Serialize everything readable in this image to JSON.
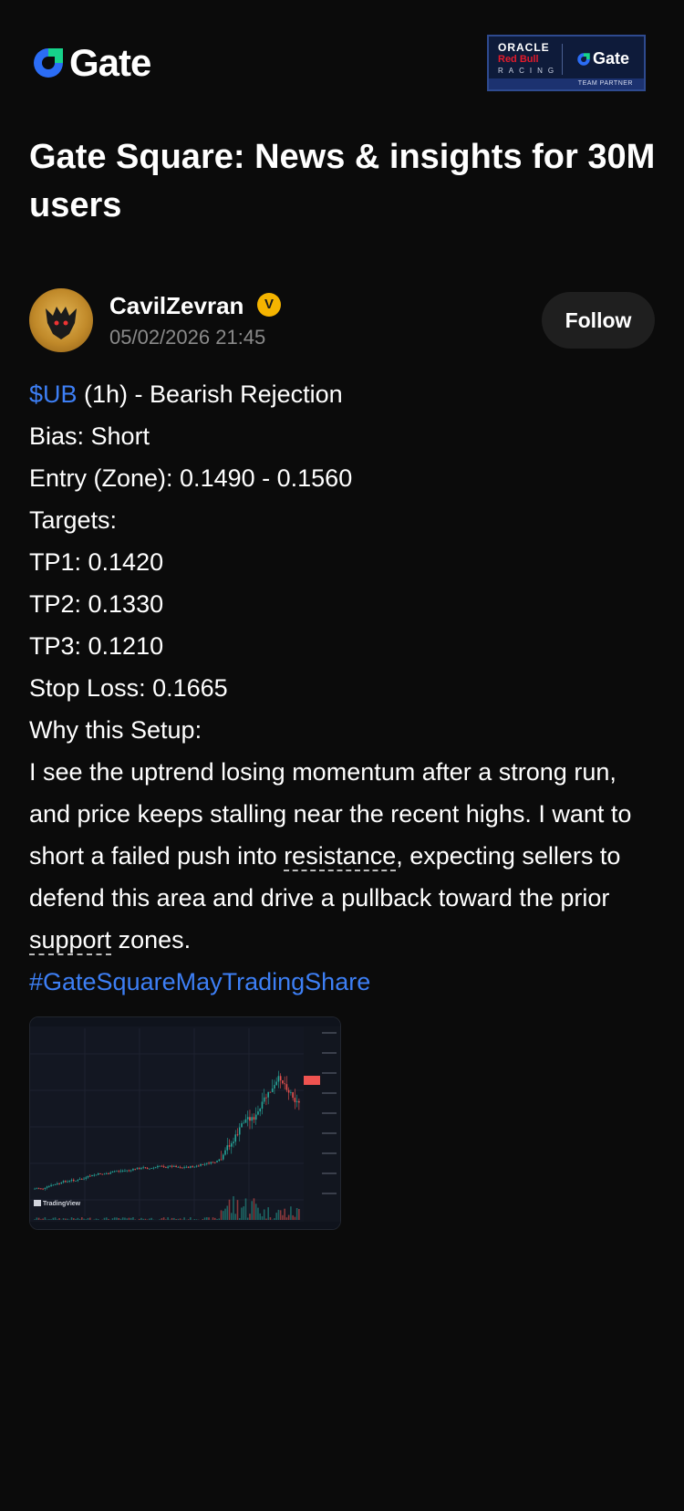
{
  "header": {
    "brand_name": "Gate",
    "partner_badge": {
      "line1": "ORACLE",
      "line2": "Red Bull",
      "line3": "RACING",
      "brand": "Gate",
      "footer": "TEAM PARTNER"
    }
  },
  "page_title": "Gate Square: News & insights for 30M users",
  "author": {
    "name": "CavilZevran",
    "verified_mark": "V",
    "timestamp": "05/02/2026 21:45",
    "follow_label": "Follow"
  },
  "post": {
    "cashtag": "$UB",
    "headline_rest": " (1h) - Bearish Rejection",
    "bias": "Bias: Short",
    "entry": "Entry (Zone): 0.1490 - 0.1560",
    "targets_label": "Targets:",
    "tp1": "TP1: 0.1420",
    "tp2": "TP2: 0.1330",
    "tp3": "TP3: 0.1210",
    "stop_loss": "Stop Loss: 0.1665",
    "why_label": "Why this Setup:",
    "para_part1": "I see the uptrend losing momentum after a strong run, and price keeps stalling near the recent highs. I want to short a failed push into ",
    "term_resistance": "resistance",
    "para_part2": ", expecting sellers to defend this area and drive a pullback toward the prior ",
    "term_support": "support",
    "para_part3": " zones.",
    "hashtag": "#GateSquareMayTradingShare"
  },
  "chart_image": {
    "watermark": "TradingView"
  },
  "colors": {
    "background": "#0b0b0b",
    "accent_blue": "#3d7ff5",
    "muted_text": "#8a8a8a",
    "follow_bg": "#1f1f1f",
    "verified_gold": "#f5b400",
    "candle_up": "#26a69a",
    "candle_down": "#ef5350"
  }
}
